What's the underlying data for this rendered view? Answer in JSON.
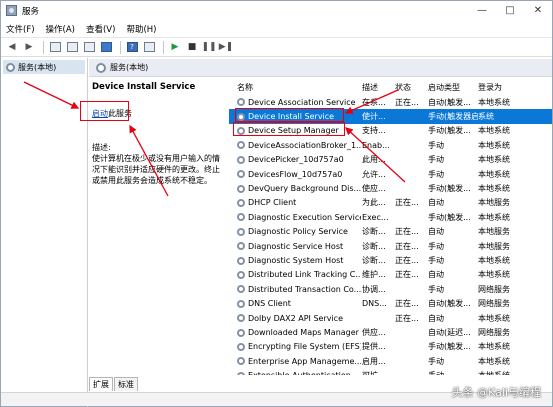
{
  "window": {
    "title": "服务"
  },
  "menu": [
    "文件(F)",
    "操作(A)",
    "查看(V)",
    "帮助(H)"
  ],
  "tree": {
    "item": "服务(本地)"
  },
  "pane_header": "服务(本地)",
  "description": {
    "title": "Device Install Service",
    "start_link": "启动",
    "start_suffix": "此服务",
    "label": "描述:",
    "body": "使计算机在极少或没有用户输入的情况下能识别并适应硬件的更改。终止或禁用此服务会造成系统不稳定。"
  },
  "columns": {
    "name": "名称",
    "desc": "描述",
    "status": "状态",
    "start": "启动类型",
    "logon": "登录为"
  },
  "rows": [
    {
      "name": "Device Association Service",
      "desc": "在系...",
      "status": "正在...",
      "start": "自动(触发...",
      "logon": "本地系统"
    },
    {
      "name": "Device Install Service",
      "desc": "使计...",
      "status": "",
      "start": "手动(触发器启动)",
      "logon": "系统"
    },
    {
      "name": "Device Setup Manager",
      "desc": "支持...",
      "status": "",
      "start": "手动(触发...",
      "logon": "本地系统"
    },
    {
      "name": "DeviceAssociationBroker_1...",
      "desc": "Enab...",
      "status": "",
      "start": "手动",
      "logon": "本地系统"
    },
    {
      "name": "DevicePicker_10d757a0",
      "desc": "此用...",
      "status": "",
      "start": "手动",
      "logon": "本地系统"
    },
    {
      "name": "DevicesFlow_10d757a0",
      "desc": "允许...",
      "status": "",
      "start": "手动",
      "logon": "本地系统"
    },
    {
      "name": "DevQuery Background Dis...",
      "desc": "使应...",
      "status": "",
      "start": "手动(触发...",
      "logon": "本地系统"
    },
    {
      "name": "DHCP Client",
      "desc": "为此...",
      "status": "正在...",
      "start": "自动",
      "logon": "本地服务"
    },
    {
      "name": "Diagnostic Execution Service",
      "desc": "Exec...",
      "status": "",
      "start": "手动(触发...",
      "logon": "本地系统"
    },
    {
      "name": "Diagnostic Policy Service",
      "desc": "诊断...",
      "status": "正在...",
      "start": "自动",
      "logon": "本地服务"
    },
    {
      "name": "Diagnostic Service Host",
      "desc": "诊断...",
      "status": "正在...",
      "start": "手动",
      "logon": "本地服务"
    },
    {
      "name": "Diagnostic System Host",
      "desc": "诊断...",
      "status": "正在...",
      "start": "手动",
      "logon": "本地系统"
    },
    {
      "name": "Distributed Link Tracking C...",
      "desc": "维护...",
      "status": "正在...",
      "start": "自动",
      "logon": "本地系统"
    },
    {
      "name": "Distributed Transaction Co...",
      "desc": "协调...",
      "status": "",
      "start": "手动",
      "logon": "网络服务"
    },
    {
      "name": "DNS Client",
      "desc": "DNS...",
      "status": "正在...",
      "start": "自动(触发...",
      "logon": "网络服务"
    },
    {
      "name": "Dolby DAX2 API Service",
      "desc": "",
      "status": "正在...",
      "start": "自动",
      "logon": "本地系统"
    },
    {
      "name": "Downloaded Maps Manager",
      "desc": "供应...",
      "status": "",
      "start": "自动(延迟...",
      "logon": "网络服务"
    },
    {
      "name": "Encrypting File System (EFS)",
      "desc": "提供...",
      "status": "",
      "start": "手动(触发...",
      "logon": "本地系统"
    },
    {
      "name": "Enterprise App Manageme...",
      "desc": "启用...",
      "status": "",
      "start": "手动",
      "logon": "本地系统"
    },
    {
      "name": "Extensible Authentication ...",
      "desc": "可扩...",
      "status": "",
      "start": "手动",
      "logon": "本地系统"
    }
  ],
  "tabs": [
    "扩展",
    "标准"
  ],
  "watermark": "头条 @Kali与编程",
  "colors": {
    "selection": "#0b78d7",
    "annotation": "#e60012",
    "link": "#0645ad"
  }
}
